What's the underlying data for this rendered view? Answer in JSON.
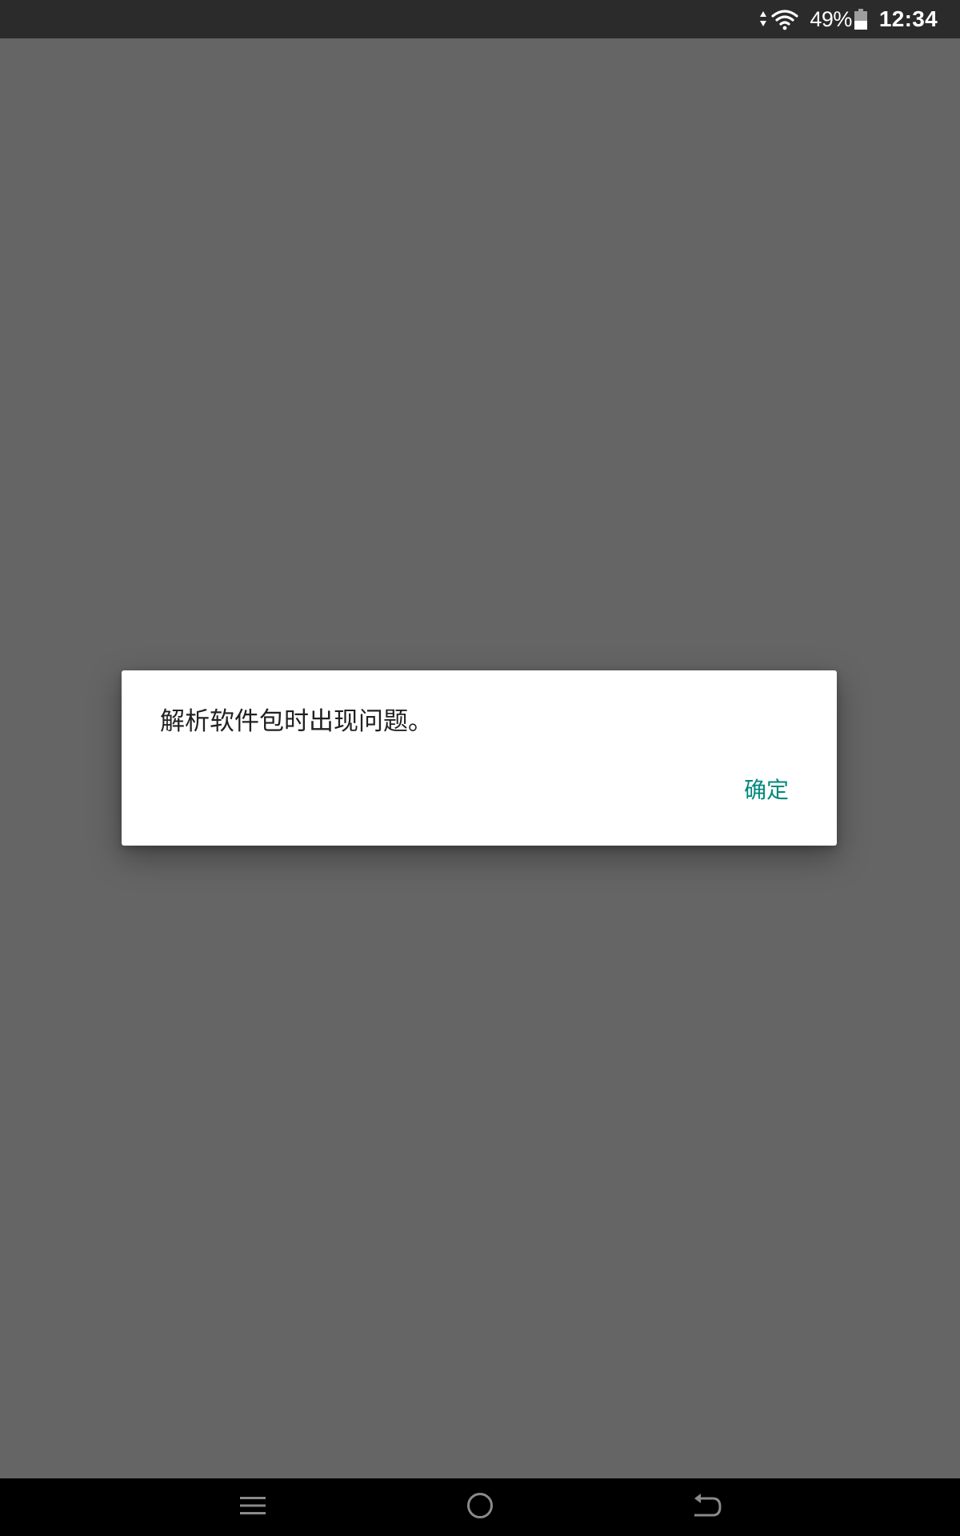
{
  "status_bar": {
    "battery_percent": "49%",
    "battery_level": 0.49,
    "time": "12:34",
    "icons": [
      "data-activity-icon",
      "wifi-icon",
      "battery-icon"
    ],
    "text_color": "#ffffff",
    "background": "#2b2b2b"
  },
  "dialog": {
    "message": "解析软件包时出现问题。",
    "ok_label": "确定",
    "accent_color": "#00897b"
  },
  "nav_bar": {
    "icons": [
      "menu-icon",
      "home-icon",
      "back-icon"
    ]
  }
}
